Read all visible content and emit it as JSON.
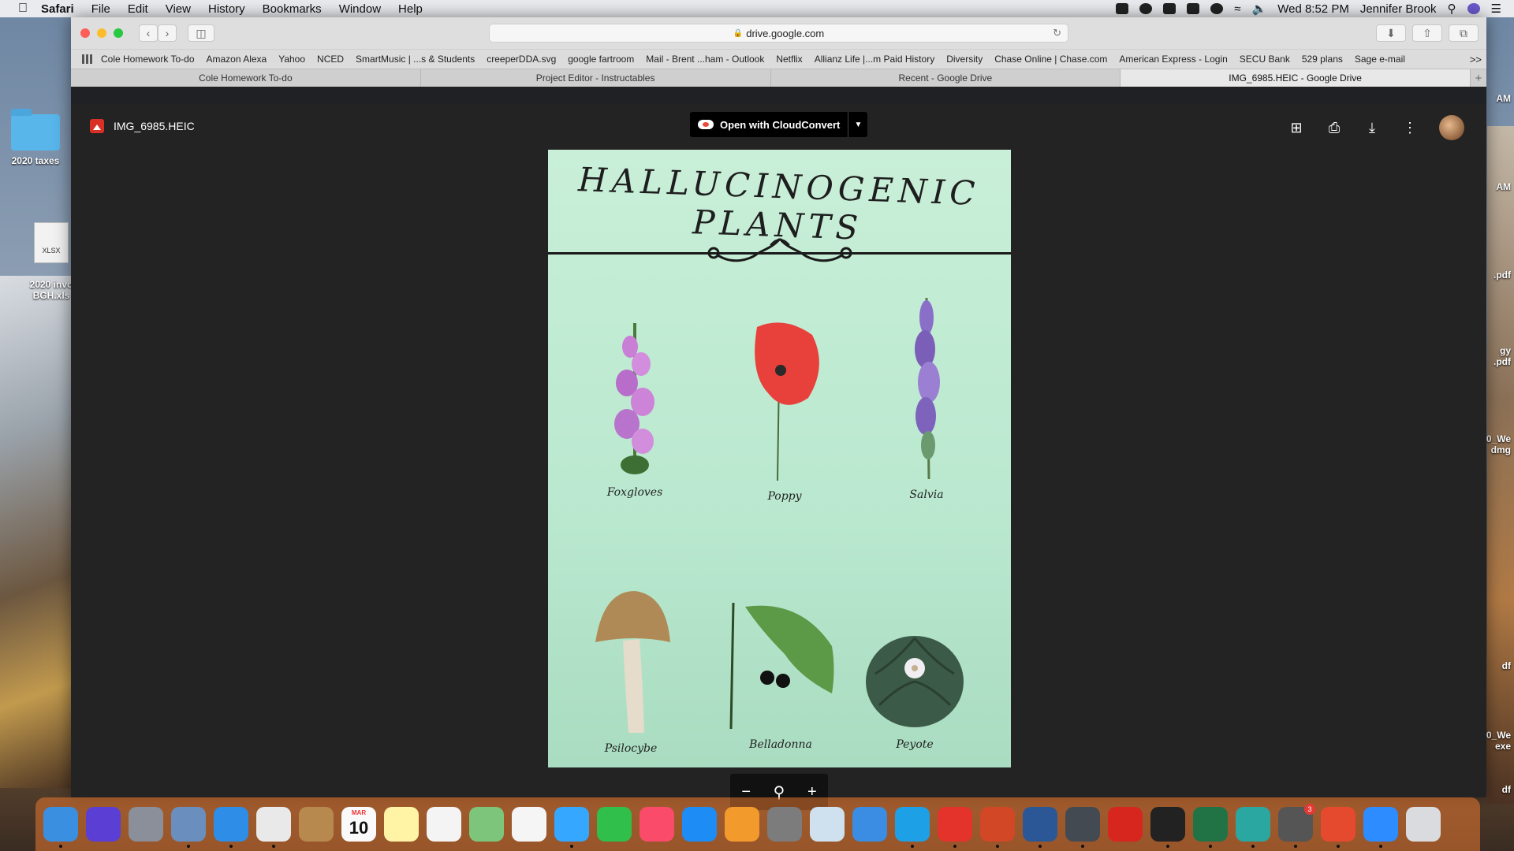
{
  "menubar": {
    "app": "Safari",
    "menus": [
      "File",
      "Edit",
      "View",
      "History",
      "Bookmarks",
      "Window",
      "Help"
    ],
    "clock": "Wed 8:52 PM",
    "user": "Jennifer Brook"
  },
  "desktop": {
    "icons": [
      {
        "label": "2020 taxes",
        "type": "folder"
      },
      {
        "label": "2020 invo\nBGH.xls",
        "type": "xlsx",
        "file_badge": "XLSX"
      }
    ],
    "right_labels": [
      "AM",
      "AM",
      ".pdf",
      "gy\n.pdf",
      "20_We\ndmg",
      "df",
      "0_We\nexe",
      "df"
    ]
  },
  "safari": {
    "url": "drive.google.com",
    "bookmarks": [
      "Cole Homework To-do",
      "Amazon Alexa",
      "Yahoo",
      "NCED",
      "SmartMusic | ...s & Students",
      "creeperDDA.svg",
      "google fartroom",
      "Mail - Brent ...ham - Outlook",
      "Netflix",
      "Allianz Life |...m Paid History",
      "Diversity",
      "Chase Online | Chase.com",
      "American Express - Login",
      "SECU Bank",
      "529 plans",
      "Sage e-mail"
    ],
    "bookmarks_more": ">>",
    "tabs": [
      {
        "label": "Cole Homework To-do",
        "active": false
      },
      {
        "label": "Project Editor - Instructables",
        "active": false
      },
      {
        "label": "Recent - Google Drive",
        "active": false
      },
      {
        "label": "IMG_6985.HEIC - Google Drive",
        "active": true
      }
    ],
    "tab_add": "+"
  },
  "viewer": {
    "file_name": "IMG_6985.HEIC",
    "open_with_label": "Open with CloudConvert",
    "poster": {
      "title": "HALLUCINOGENIC PLANTS",
      "plants": [
        {
          "name": "Foxgloves",
          "color": "#c97fd6"
        },
        {
          "name": "Poppy",
          "color": "#e8403a"
        },
        {
          "name": "Salvia",
          "color": "#8a6fc9"
        },
        {
          "name": "Psilocybe",
          "color": "#b08a56"
        },
        {
          "name": "Belladonna",
          "color": "#3b7a2f"
        },
        {
          "name": "Peyote",
          "color": "#3c5a48"
        }
      ]
    },
    "zoom": {
      "minus": "−",
      "plus": "+"
    }
  },
  "dock": {
    "apps": [
      {
        "name": "finder",
        "color": "#3b8fe0",
        "running": true
      },
      {
        "name": "siri",
        "color": "#5b3fd4",
        "running": false
      },
      {
        "name": "launchpad",
        "color": "#8a8f99",
        "running": false
      },
      {
        "name": "mail-stamp",
        "color": "#6a8fbf",
        "running": true
      },
      {
        "name": "safari",
        "color": "#2e8de6",
        "running": true
      },
      {
        "name": "chrome",
        "color": "#e9e9e9",
        "running": true
      },
      {
        "name": "contacts",
        "color": "#b7894f",
        "running": false
      },
      {
        "name": "calendar",
        "color": "#fafafa",
        "running": false,
        "month": "MAR",
        "day": "10"
      },
      {
        "name": "notes",
        "color": "#fff3a6",
        "running": false
      },
      {
        "name": "reminders",
        "color": "#f4f4f4",
        "running": false
      },
      {
        "name": "maps",
        "color": "#7cc57a",
        "running": false
      },
      {
        "name": "photos",
        "color": "#f5f5f5",
        "running": false
      },
      {
        "name": "messages",
        "color": "#35a7ff",
        "running": true
      },
      {
        "name": "facetime",
        "color": "#2fbf4a",
        "running": false
      },
      {
        "name": "music",
        "color": "#fa4c6a",
        "running": false
      },
      {
        "name": "app-store",
        "color": "#1d8cf5",
        "running": false
      },
      {
        "name": "books",
        "color": "#f39a2d",
        "running": false
      },
      {
        "name": "system-preferences",
        "color": "#7c7c7c",
        "running": false
      },
      {
        "name": "preview",
        "color": "#cfe0ee",
        "running": false
      },
      {
        "name": "xcode-tool",
        "color": "#3a8de2",
        "running": false
      },
      {
        "name": "skype",
        "color": "#1ea0e6",
        "running": true
      },
      {
        "name": "acrobat-pdf",
        "color": "#e3332b",
        "running": true
      },
      {
        "name": "powerpoint",
        "color": "#d24726",
        "running": true
      },
      {
        "name": "word",
        "color": "#2b5797",
        "running": true
      },
      {
        "name": "security-shield",
        "color": "#444a52",
        "running": true
      },
      {
        "name": "acrobat",
        "color": "#d7261e",
        "running": false
      },
      {
        "name": "acrobat-dc",
        "color": "#222222",
        "running": true
      },
      {
        "name": "excel",
        "color": "#217346",
        "running": true
      },
      {
        "name": "sync",
        "color": "#2aa7a0",
        "running": true
      },
      {
        "name": "printer",
        "color": "#555555",
        "running": true,
        "badge": "3"
      },
      {
        "name": "remote-desktop",
        "color": "#e64a2e",
        "running": true
      },
      {
        "name": "zoom",
        "color": "#2d8cff",
        "running": true
      },
      {
        "name": "trash",
        "color": "#d9dbde",
        "running": false
      }
    ]
  }
}
